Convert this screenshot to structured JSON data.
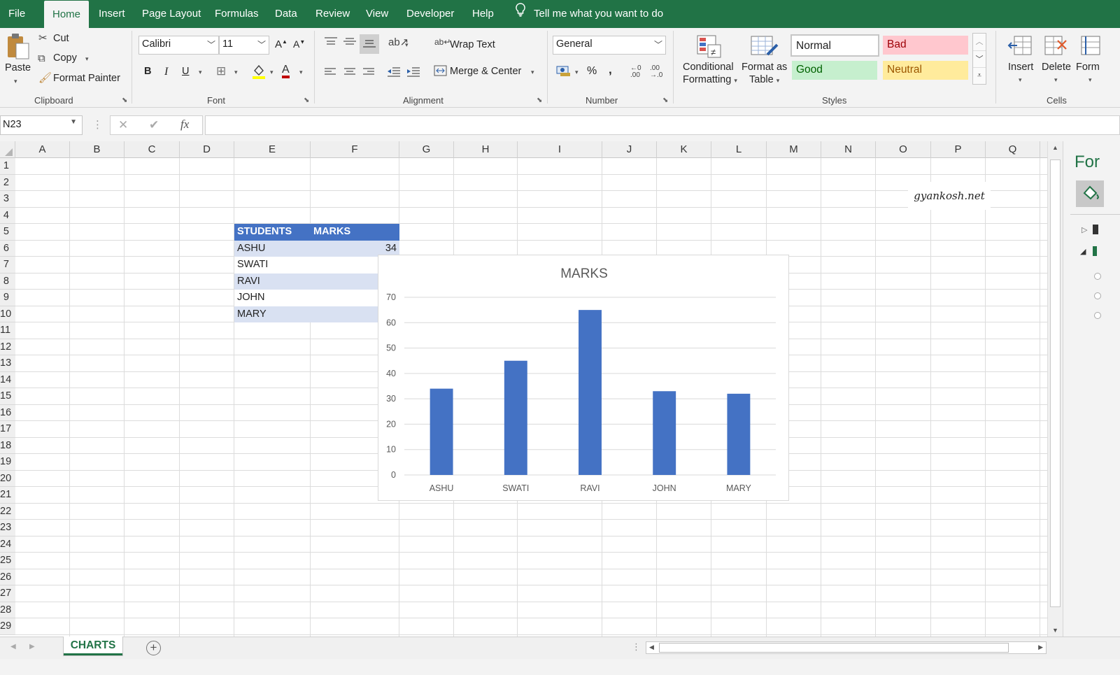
{
  "menu": {
    "file": "File",
    "tabs": [
      "Home",
      "Insert",
      "Page Layout",
      "Formulas",
      "Data",
      "Review",
      "View",
      "Developer",
      "Help"
    ],
    "tell_me": "Tell me what you want to do"
  },
  "ribbon": {
    "clipboard": {
      "paste": "Paste",
      "cut": "Cut",
      "copy": "Copy",
      "format_painter": "Format Painter",
      "group": "Clipboard"
    },
    "font": {
      "family": "Calibri",
      "size": "11",
      "bold": "B",
      "italic": "I",
      "underline": "U",
      "font_color": "A",
      "grow": "A",
      "shrink": "A",
      "group": "Font"
    },
    "alignment": {
      "wrap_text": "Wrap Text",
      "merge_center": "Merge & Center",
      "group": "Alignment"
    },
    "number": {
      "format": "General",
      "percent": "%",
      "comma": ",",
      "group": "Number"
    },
    "styles": {
      "conditional_1": "Conditional",
      "conditional_2": "Formatting",
      "format_table_1": "Format as",
      "format_table_2": "Table",
      "normal": "Normal",
      "bad": "Bad",
      "good": "Good",
      "neutral": "Neutral",
      "group": "Styles"
    },
    "cells": {
      "insert": "Insert",
      "delete": "Delete",
      "format": "Form",
      "group": "Cells"
    }
  },
  "formula_bar": {
    "name_box": "N23",
    "fx": "fx",
    "value": ""
  },
  "columns": [
    "A",
    "B",
    "C",
    "D",
    "E",
    "F",
    "G",
    "H",
    "I",
    "J",
    "K",
    "L",
    "M",
    "N",
    "O",
    "P",
    "Q"
  ],
  "rows": [
    "1",
    "2",
    "3",
    "4",
    "5",
    "6",
    "7",
    "8",
    "9",
    "10",
    "11",
    "12",
    "13",
    "14",
    "15",
    "16",
    "17",
    "18",
    "19",
    "20",
    "21",
    "22",
    "23",
    "24",
    "25",
    "26",
    "27",
    "28",
    "29"
  ],
  "table": {
    "headers": [
      "STUDENTS",
      "MARKS"
    ],
    "rows": [
      {
        "student": "ASHU",
        "marks": "34"
      },
      {
        "student": "SWATI",
        "marks": ""
      },
      {
        "student": "RAVI",
        "marks": ""
      },
      {
        "student": "JOHN",
        "marks": ""
      },
      {
        "student": "MARY",
        "marks": ""
      }
    ]
  },
  "watermark": "gyankosh.net",
  "chart_data": {
    "type": "bar",
    "title": "MARKS",
    "categories": [
      "ASHU",
      "SWATI",
      "RAVI",
      "JOHN",
      "MARY"
    ],
    "values": [
      34,
      45,
      65,
      33,
      32
    ],
    "ylim": [
      0,
      70
    ],
    "yticks": [
      "0",
      "10",
      "20",
      "30",
      "40",
      "50",
      "60",
      "70"
    ],
    "grid": true,
    "bar_color": "#4472c4"
  },
  "sheet_tabs": [
    "CHARTS"
  ],
  "pane": {
    "title": "For"
  },
  "colors": {
    "accent": "#217346",
    "header_fill": "#4472c4",
    "band_fill": "#d9e1f2",
    "bad_fill": "#ffc7ce",
    "good_fill": "#c6efce",
    "neutral_fill": "#ffeb9c"
  }
}
